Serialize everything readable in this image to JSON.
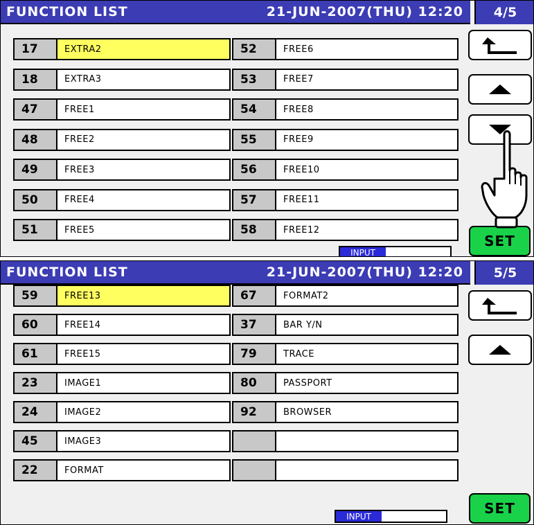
{
  "screens": [
    {
      "title": "FUNCTION LIST",
      "datetime": "21-JUN-2007(THU) 12:20",
      "page": "4/5",
      "left_items": [
        {
          "num": "17",
          "label": "EXTRA2",
          "selected": true
        },
        {
          "num": "18",
          "label": "EXTRA3"
        },
        {
          "num": "47",
          "label": "FREE1"
        },
        {
          "num": "48",
          "label": "FREE2"
        },
        {
          "num": "49",
          "label": "FREE3"
        },
        {
          "num": "50",
          "label": "FREE4"
        },
        {
          "num": "51",
          "label": "FREE5"
        }
      ],
      "right_items": [
        {
          "num": "52",
          "label": "FREE6"
        },
        {
          "num": "53",
          "label": "FREE7"
        },
        {
          "num": "54",
          "label": "FREE8"
        },
        {
          "num": "55",
          "label": "FREE9"
        },
        {
          "num": "56",
          "label": "FREE10"
        },
        {
          "num": "57",
          "label": "FREE11"
        },
        {
          "num": "58",
          "label": "FREE12"
        }
      ],
      "input_label": "INPUT",
      "set_label": "SET",
      "buttons": [
        "back-arrow-icon",
        "up-arrow-icon",
        "down-arrow-icon"
      ]
    },
    {
      "title": "FUNCTION LIST",
      "datetime": "21-JUN-2007(THU) 12:20",
      "page": "5/5",
      "left_items": [
        {
          "num": "59",
          "label": "FREE13",
          "selected": true
        },
        {
          "num": "60",
          "label": "FREE14"
        },
        {
          "num": "61",
          "label": "FREE15"
        },
        {
          "num": "23",
          "label": "IMAGE1"
        },
        {
          "num": "24",
          "label": "IMAGE2"
        },
        {
          "num": "45",
          "label": "IMAGE3"
        },
        {
          "num": "22",
          "label": "FORMAT"
        }
      ],
      "right_items": [
        {
          "num": "67",
          "label": "FORMAT2"
        },
        {
          "num": "37",
          "label": "BAR Y/N"
        },
        {
          "num": "79",
          "label": "TRACE"
        },
        {
          "num": "80",
          "label": "PASSPORT"
        },
        {
          "num": "92",
          "label": "BROWSER"
        },
        {
          "num": "",
          "label": ""
        },
        {
          "num": "",
          "label": ""
        }
      ],
      "input_label": "INPUT",
      "set_label": "SET",
      "buttons": [
        "back-arrow-icon",
        "up-arrow-icon"
      ]
    }
  ],
  "colors": {
    "title_bar": "#3c3cb4",
    "selected": "#ffff60",
    "set_button": "#19d24a",
    "number_cell": "#c8c8c8"
  }
}
